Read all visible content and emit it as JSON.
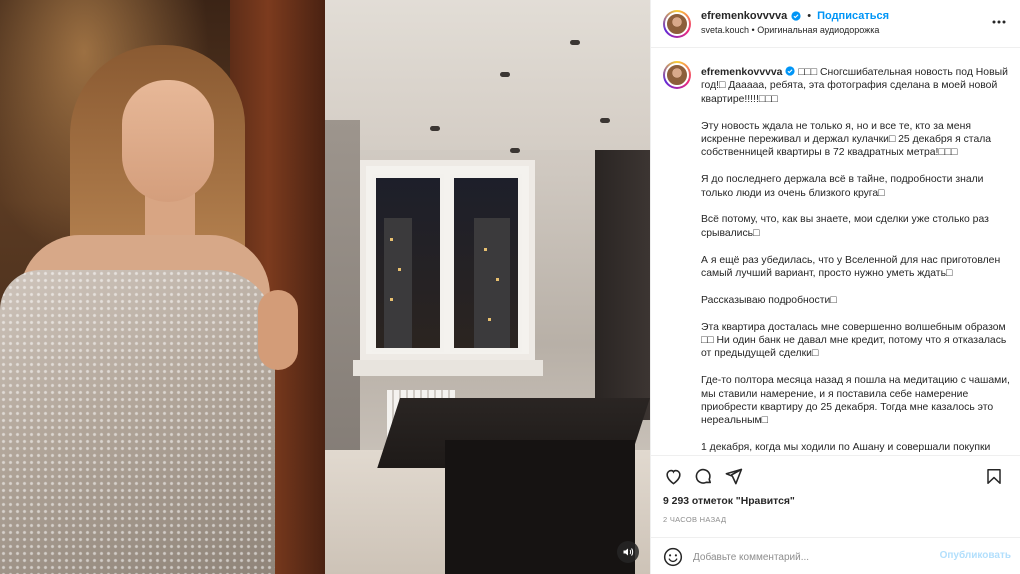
{
  "header": {
    "username": "efremenkovvvva",
    "separator": "•",
    "follow_label": "Подписаться",
    "audio_user": "sveta.kouch",
    "audio_label": "Оригинальная аудиодорожка"
  },
  "caption": {
    "username": "efremenkovvvva",
    "first_line": "□□□ Сногсшибательная новость под Новый год!□ Дааааа, ребята, эта фотография сделана в моей новой квартире!!!!!□□□",
    "paragraphs": [
      "Эту новость ждала не только я, но и все те, кто за меня искренне переживал и держал кулачки□ 25 декабря я стала собственницей квартиры в 72 квадратных метра!□□□",
      "Я до последнего держала всё в тайне, подробности знали только люди из очень близкого круга□",
      "Всё потому, что, как вы знаете, мои сделки уже столько раз срывались□",
      "А я ещё раз убедилась, что у Вселенной для нас приготовлен самый лучший вариант, просто нужно уметь ждать□",
      "Рассказываю подробности□",
      "Эта квартира досталась мне совершенно волшебным образом □□ Ни один банк не давал мне кредит, потому что я отказалась от предыдущей сделки□",
      "Где-то полтора месяца назад я пошла на медитацию с чашами, мы ставили намерение, и я поставила себе намерение приобрести квартиру до 25 декабря. Тогда мне казалось это нереальным□",
      "1 декабря, когда мы ходили по Ашану и совершали покупки"
    ]
  },
  "stats": {
    "likes": "9 293 отметок \"Нравится\"",
    "time": "2 ЧАСОВ НАЗАД"
  },
  "comment": {
    "placeholder": "Добавьте комментарий...",
    "publish_label": "Опубликовать"
  },
  "colors": {
    "accent": "#0095f6",
    "publish_disabled": "#b2dffc",
    "muted": "#8e8e8e",
    "text": "#262626"
  },
  "icons": {
    "verified": "verified-badge-icon",
    "more": "more-options-icon",
    "like": "heart-icon",
    "comment": "comment-icon",
    "share": "share-icon",
    "save": "bookmark-icon",
    "emoji": "emoji-icon",
    "audio": "audio-icon"
  }
}
